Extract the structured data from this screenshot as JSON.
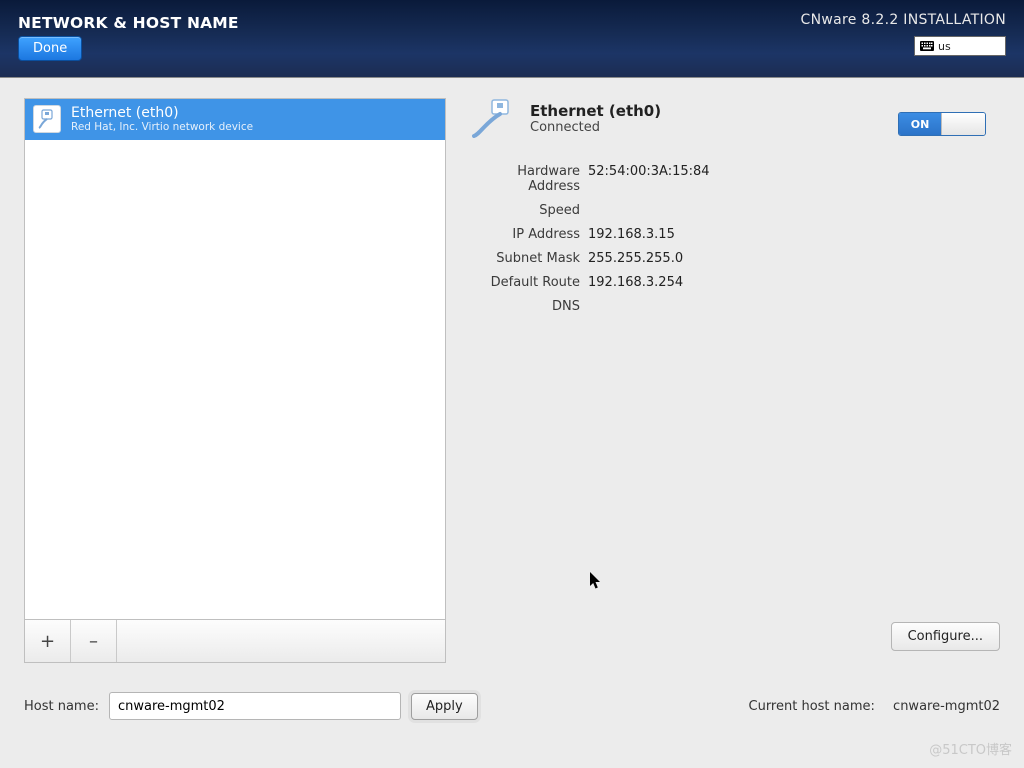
{
  "header": {
    "title": "NETWORK & HOST NAME",
    "done_label": "Done",
    "install_title": "CNware 8.2.2 INSTALLATION",
    "keyboard_layout": "us"
  },
  "interfaces": {
    "items": [
      {
        "name": "Ethernet (eth0)",
        "subtitle": "Red Hat, Inc. Virtio network device"
      }
    ]
  },
  "details": {
    "title": "Ethernet (eth0)",
    "status": "Connected",
    "toggle_on_label": "ON",
    "fields": {
      "hardware_address": {
        "label": "Hardware Address",
        "value": "52:54:00:3A:15:84"
      },
      "speed": {
        "label": "Speed",
        "value": ""
      },
      "ip_address": {
        "label": "IP Address",
        "value": "192.168.3.15"
      },
      "subnet_mask": {
        "label": "Subnet Mask",
        "value": "255.255.255.0"
      },
      "default_route": {
        "label": "Default Route",
        "value": "192.168.3.254"
      },
      "dns": {
        "label": "DNS",
        "value": ""
      }
    },
    "configure_label": "Configure..."
  },
  "hostname": {
    "label": "Host name:",
    "value": "cnware-mgmt02",
    "apply_label": "Apply",
    "current_label": "Current host name:",
    "current_value": "cnware-mgmt02"
  },
  "watermark": "@51CTO博客"
}
